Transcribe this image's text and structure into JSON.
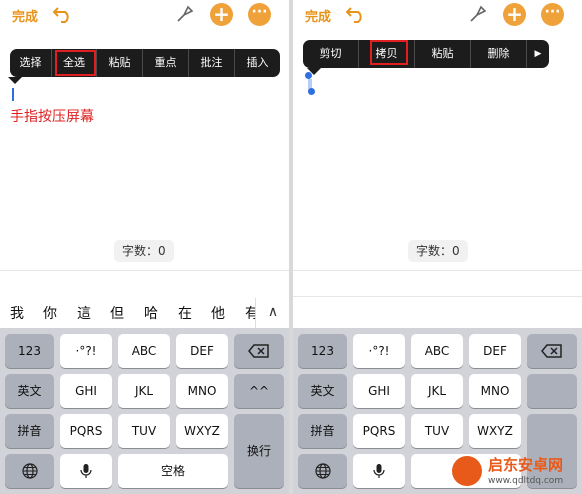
{
  "topbar": {
    "done_label": "完成"
  },
  "left": {
    "menu_items": [
      "选择",
      "全选",
      "粘贴",
      "重点",
      "批注",
      "插入"
    ],
    "highlighted_item": "全选",
    "annotation_text": "手指按压屏幕",
    "word_count": "字数：0",
    "candidates": [
      "我",
      "你",
      "這",
      "但",
      "哈",
      "在",
      "他",
      "有"
    ]
  },
  "right": {
    "menu_items": [
      "剪切",
      "拷贝",
      "粘贴",
      "删除"
    ],
    "menu_arrow": "▶",
    "highlighted_item": "拷贝",
    "word_count": "字数：0"
  },
  "keyboard": {
    "row1": [
      "123",
      "·°?!",
      "ABC",
      "DEF"
    ],
    "row2": [
      "英文",
      "GHI",
      "JKL",
      "MNO",
      "^^"
    ],
    "row3": [
      "拼音",
      "PQRS",
      "TUV",
      "WXYZ"
    ],
    "enter_label": "换行",
    "space_label": "空格"
  },
  "watermark": {
    "title": "启东安卓网",
    "url": "www.qdltdq.com"
  },
  "colors": {
    "accent": "#e8941a",
    "highlight": "#e02020",
    "menu_bg": "#1c1c1c",
    "keyboard_bg": "#d1d3d9"
  }
}
